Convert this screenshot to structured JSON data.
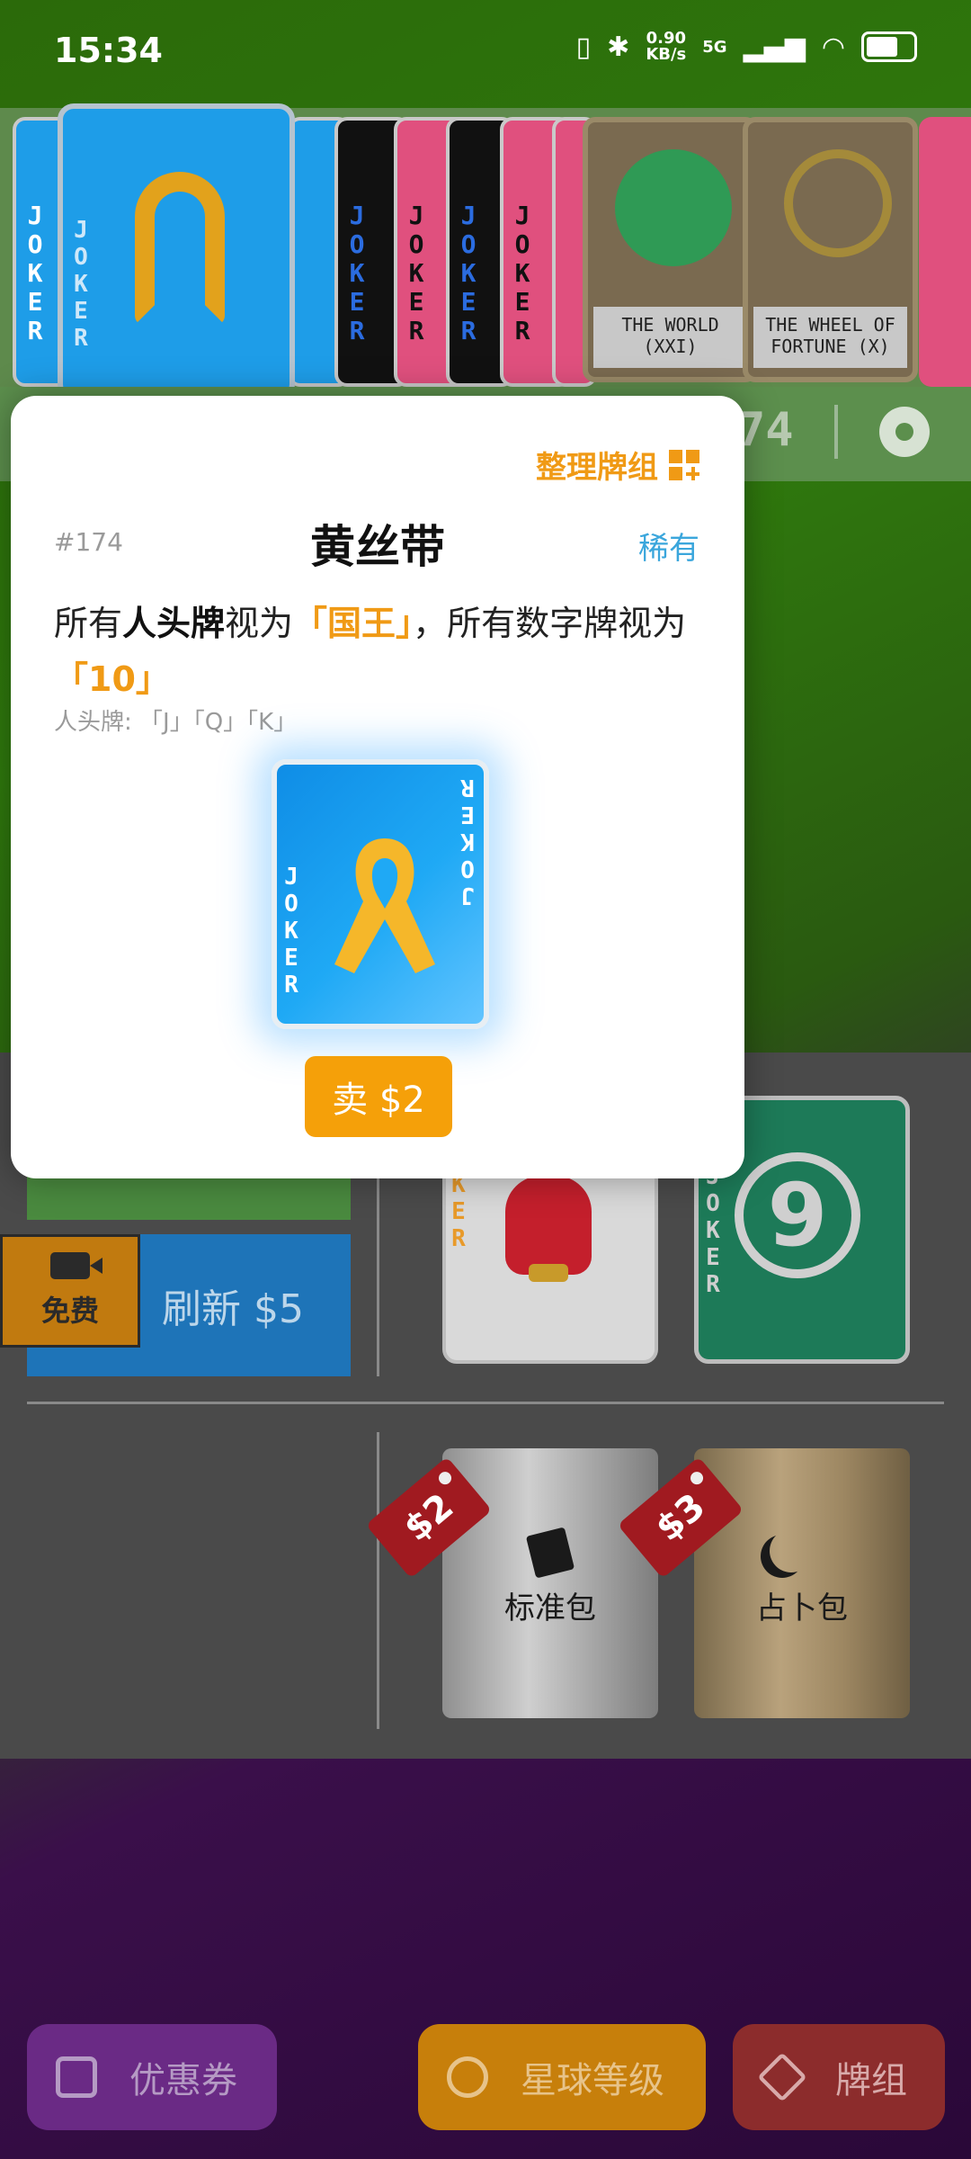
{
  "status_bar": {
    "time": "15:34",
    "net_speed_value": "0.90",
    "net_speed_unit": "KB/s",
    "network": "5G",
    "icons": [
      "vibrate-icon",
      "bluetooth-icon",
      "signal-icon",
      "wifi-icon",
      "battery-icon"
    ]
  },
  "joker_row": {
    "card_letters": "JOKER",
    "tarot_cards": [
      {
        "name_line1": "THE WORLD",
        "name_line2": "(XXI)"
      },
      {
        "name_line1": "THE WHEEL OF",
        "name_line2": "FORTUNE (X)"
      }
    ]
  },
  "info_bar": {
    "count_partial": "74"
  },
  "modal": {
    "organize_label": "整理牌组",
    "card_id": "#174",
    "card_title": "黄丝带",
    "rarity": "稀有",
    "desc_part1": "所有",
    "desc_bold": "人头牌",
    "desc_part2": "视为",
    "desc_hl1": "「国王」",
    "desc_part3": "，所有数字牌视为",
    "desc_hl2": "「10」",
    "note": "人头牌: 「J」「Q」「K」",
    "sell_label": "卖 $2"
  },
  "shop": {
    "free_label": "免费",
    "refresh_label": "刷新 $5",
    "packs": [
      {
        "name": "标准包",
        "price": "$2"
      },
      {
        "name": "占卜包",
        "price": "$3"
      }
    ],
    "nine_card_value": "9"
  },
  "bottom_nav": {
    "coupon_label": "优惠券",
    "planet_label": "星球等级",
    "deck_label": "牌组"
  },
  "colors": {
    "accent_orange": "#f09a15",
    "rarity_blue": "#3aa6dc",
    "joker_blue": "#1e9de8"
  }
}
